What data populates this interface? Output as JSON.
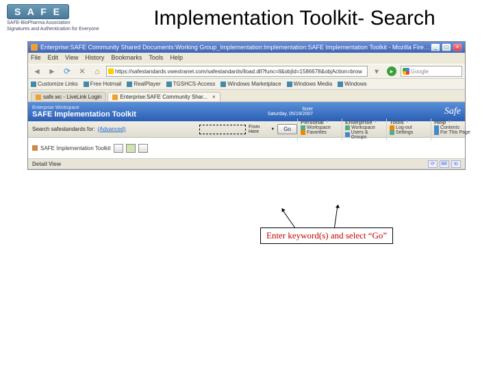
{
  "slide": {
    "title": "Implementation Toolkit- Search",
    "logo_text": "S A F E",
    "logo_sub1": "SAFE-BioPharma Association",
    "logo_sub2": "Signatures and Authentication for Everyone"
  },
  "browser": {
    "window_title": "Enterprise:SAFE Community Shared Documents:Working Group_Implementation:Implementation:SAFE Implementation Toolkit - Mozilla Firefox",
    "winbtns": {
      "min": "_",
      "max": "□",
      "close": "×"
    },
    "menubar": [
      "File",
      "Edit",
      "View",
      "History",
      "Bookmarks",
      "Tools",
      "Help"
    ],
    "url": "https://safestandards.vwextranet.com/safestandards/lload.dll?func=ll&objId=1586678&objAction=brow",
    "search_placeholder": "Google",
    "bookmarks": [
      "Customize Links",
      "Free Hotmail",
      "RealPlayer",
      "TGSHCS-Access",
      "Windows Marketplace",
      "Windows Media",
      "Windows"
    ],
    "tabs": [
      {
        "label": "safe.wc - LiveLink Login",
        "active": false
      },
      {
        "label": "Enterprise:SAFE Community Shar...",
        "active": true
      }
    ]
  },
  "app": {
    "header_small": "Enterprise Workspace",
    "header_large": "SAFE Implementation Toolkit",
    "header_user": "fozer",
    "header_date": "Saturday, 05/19/2007",
    "header_brand": "Safe",
    "search_label": "Search safestandards for:",
    "advanced": "(Advanced)",
    "from_here": "From Here",
    "go": "Go",
    "menus": [
      {
        "head": "Personal",
        "items": [
          {
            "t": "Workspace"
          },
          {
            "t": "Favorites"
          }
        ]
      },
      {
        "head": "Enterprise",
        "items": [
          {
            "t": "Workspace"
          },
          {
            "t": "Users & Groups"
          }
        ]
      },
      {
        "head": "Tools",
        "items": [
          {
            "t": "Log-out"
          },
          {
            "t": "Settings"
          }
        ]
      },
      {
        "head": "Help",
        "items": [
          {
            "t": "Contents"
          },
          {
            "t": "For This Page"
          }
        ]
      }
    ],
    "breadcrumb": "SAFE Implementation Toolkit",
    "detail": "Detail View",
    "ricons": [
      "⟳",
      "BE",
      "to"
    ]
  },
  "annotation": "Enter keyword(s) and select “Go”"
}
